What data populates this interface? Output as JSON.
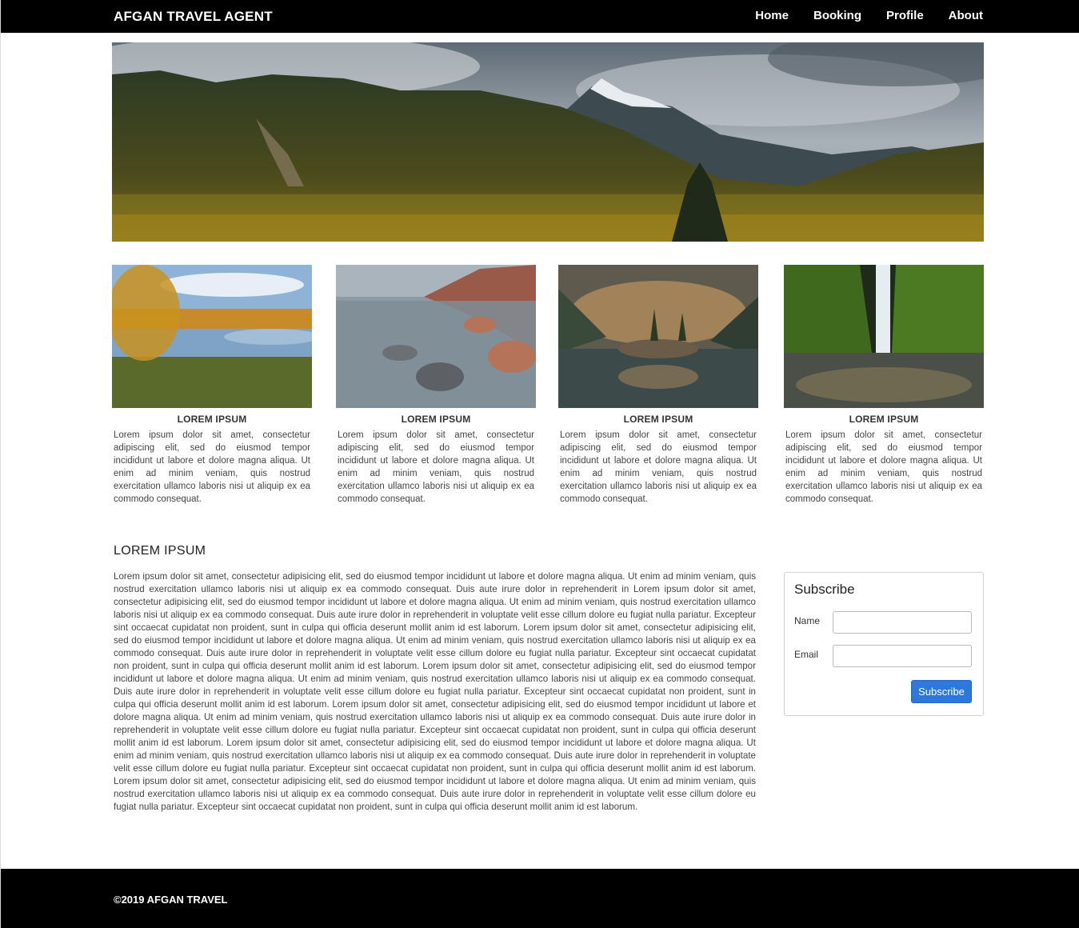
{
  "header": {
    "brand": "AFGAN TRAVEL AGENT",
    "nav": [
      "Home",
      "Booking",
      "Profile",
      "About"
    ]
  },
  "cards": [
    {
      "title": "LOREM IPSUM",
      "text": "Lorem ipsum dolor sit amet, consectetur adipiscing elit, sed do eiusmod tempor incididunt ut labore et dolore magna aliqua. Ut enim ad minim veniam, quis nostrud exercitation ullamco laboris nisi ut aliquip ex ea commodo consequat."
    },
    {
      "title": "LOREM IPSUM",
      "text": "Lorem ipsum dolor sit amet, consectetur adipiscing elit, sed do eiusmod tempor incididunt ut labore et dolore magna aliqua. Ut enim ad minim veniam, quis nostrud exercitation ullamco laboris nisi ut aliquip ex ea commodo consequat."
    },
    {
      "title": "LOREM IPSUM",
      "text": "Lorem ipsum dolor sit amet, consectetur adipiscing elit, sed do eiusmod tempor incididunt ut labore et dolore magna aliqua. Ut enim ad minim veniam, quis nostrud exercitation ullamco laboris nisi ut aliquip ex ea commodo consequat."
    },
    {
      "title": "LOREM IPSUM",
      "text": "Lorem ipsum dolor sit amet, consectetur adipiscing elit, sed do eiusmod tempor incididunt ut labore et dolore magna aliqua. Ut enim ad minim veniam, quis nostrud exercitation ullamco laboris nisi ut aliquip ex ea commodo consequat."
    }
  ],
  "article": {
    "title": "LOREM IPSUM",
    "body": "Lorem ipsum dolor sit amet, consectetur adipisicing elit, sed do eiusmod tempor incididunt ut labore et dolore magna aliqua. Ut enim ad minim veniam, quis nostrud exercitation ullamco laboris nisi ut aliquip ex ea commodo consequat. Duis aute irure dolor in reprehenderit in Lorem ipsum dolor sit amet, consectetur adipisicing elit, sed do eiusmod tempor incididunt ut labore et dolore magna aliqua. Ut enim ad minim veniam, quis nostrud exercitation ullamco laboris nisi ut aliquip ex ea commodo consequat. Duis aute irure dolor in reprehenderit in voluptate velit esse cillum dolore eu fugiat nulla pariatur. Excepteur sint occaecat cupidatat non proident, sunt in culpa qui officia deserunt mollit anim id est laborum. Lorem ipsum dolor sit amet, consectetur adipisicing elit, sed do eiusmod tempor incididunt ut labore et dolore magna aliqua. Ut enim ad minim veniam, quis nostrud exercitation ullamco laboris nisi ut aliquip ex ea commodo consequat. Duis aute irure dolor in reprehenderit in voluptate velit esse cillum dolore eu fugiat nulla pariatur. Excepteur sint occaecat cupidatat non proident, sunt in culpa qui officia deserunt mollit anim id est laborum. Lorem ipsum dolor sit amet, consectetur adipisicing elit, sed do eiusmod tempor incididunt ut labore et dolore magna aliqua. Ut enim ad minim veniam, quis nostrud exercitation ullamco laboris nisi ut aliquip ex ea commodo consequat. Duis aute irure dolor in reprehenderit in voluptate velit esse cillum dolore eu fugiat nulla pariatur. Excepteur sint occaecat cupidatat non proident, sunt in culpa qui officia deserunt mollit anim id est laborum. Lorem ipsum dolor sit amet, consectetur adipisicing elit, sed do eiusmod tempor incididunt ut labore et dolore magna aliqua. Ut enim ad minim veniam, quis nostrud exercitation ullamco laboris nisi ut aliquip ex ea commodo consequat. Duis aute irure dolor in reprehenderit in voluptate velit esse cillum dolore eu fugiat nulla pariatur. Excepteur sint occaecat cupidatat non proident, sunt in culpa qui officia deserunt mollit anim id est laborum. Lorem ipsum dolor sit amet, consectetur adipisicing elit, sed do eiusmod tempor incididunt ut labore et dolore magna aliqua. Ut enim ad minim veniam, quis nostrud exercitation ullamco laboris nisi ut aliquip ex ea commodo consequat. Duis aute irure dolor in reprehenderit in voluptate velit esse cillum dolore eu fugiat nulla pariatur. Excepteur sint occaecat cupidatat non proident, sunt in culpa qui officia deserunt mollit anim id est laborum. Lorem ipsum dolor sit amet, consectetur adipisicing elit, sed do eiusmod tempor incididunt ut labore et dolore magna aliqua. Ut enim ad minim veniam, quis nostrud exercitation ullamco laboris nisi ut aliquip ex ea commodo consequat. Duis aute irure dolor in reprehenderit in voluptate velit esse cillum dolore eu fugiat nulla pariatur. Excepteur sint occaecat cupidatat non proident, sunt in culpa qui officia deserunt mollit anim id est laborum."
  },
  "subscribe": {
    "title": "Subscribe",
    "name_label": "Name",
    "email_label": "Email",
    "name_value": "",
    "email_value": "",
    "button": "Subscribe"
  },
  "footer": {
    "copyright": "©2019 AFGAN TRAVEL"
  },
  "colors": {
    "bar": "#000000",
    "button": "#2d78dd"
  }
}
